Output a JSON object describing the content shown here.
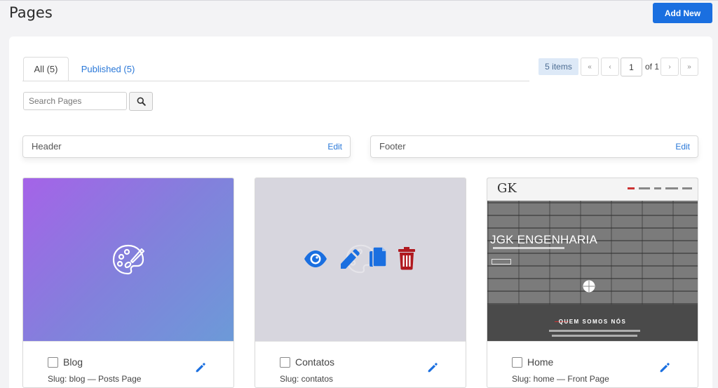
{
  "header": {
    "title": "Pages",
    "add_new_label": "Add New"
  },
  "tabs": [
    {
      "label": "All (5)",
      "active": true
    },
    {
      "label": "Published (5)",
      "active": false
    }
  ],
  "pagination": {
    "items_label": "5 items",
    "first": "«",
    "prev": "‹",
    "next": "›",
    "last": "»",
    "current_page": "1",
    "of_label": "of 1"
  },
  "search": {
    "placeholder": "Search Pages",
    "icon": "search-icon"
  },
  "template_parts": [
    {
      "label": "Header",
      "edit_label": "Edit"
    },
    {
      "label": "Footer",
      "edit_label": "Edit"
    }
  ],
  "cards": [
    {
      "title": "Blog",
      "slug": "Slug: blog — Posts Page",
      "thumbnail_icon": "palette-icon"
    },
    {
      "title": "Contatos",
      "slug": "Slug: contatos",
      "overlay_icons": [
        "eye-icon",
        "pencil-icon",
        "copy-icon",
        "trash-icon"
      ]
    },
    {
      "title": "Home",
      "slug": "Slug: home — Front Page",
      "preview": {
        "logo": "GK",
        "hero_title": "JGK ENGENHARIA",
        "section_title": "QUEM SOMOS NÓS"
      }
    }
  ],
  "colors": {
    "primary": "#1a6fe0",
    "link": "#2a78d8",
    "delete": "#b0191f",
    "panel": "#ffffff",
    "background": "#f3f3f5"
  }
}
